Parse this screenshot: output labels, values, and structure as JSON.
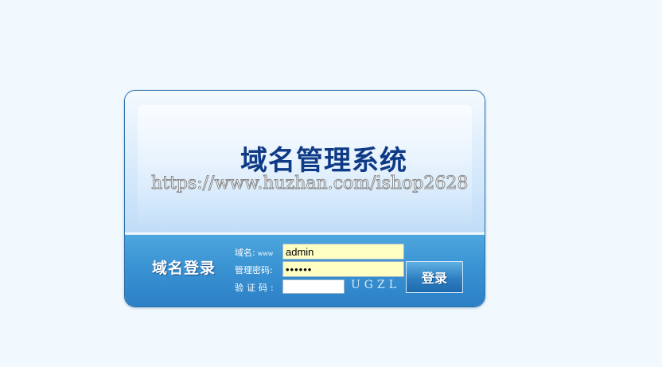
{
  "header": {
    "title": "域名管理系统",
    "watermark": "https://www.huzhan.com/ishop2628"
  },
  "login": {
    "section_label": "域名登录",
    "domain_label": "域名:",
    "domain_suffix": "www",
    "domain_value": "admin",
    "password_label": "管理密码:",
    "password_value": "••••••",
    "code_label": "验证码:",
    "code_value": "",
    "captcha_text": "UGZL",
    "submit_label": "登录"
  },
  "colors": {
    "title": "#0e3a86",
    "panel_blue": "#3a93d3",
    "input_fill": "#ffffc3"
  }
}
